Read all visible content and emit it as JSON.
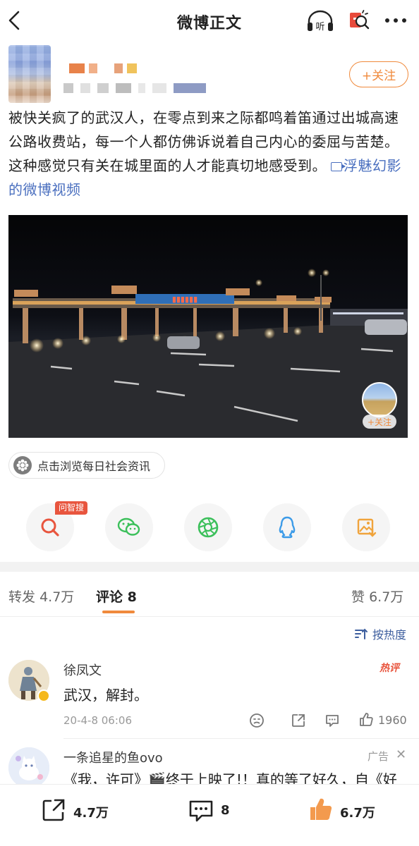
{
  "header": {
    "title": "微博正文",
    "back_icon": "chevron-left-icon",
    "listen_label": "听",
    "more_icon": "more-dots-icon"
  },
  "author": {
    "follow_label": "+关注"
  },
  "post": {
    "text": "被快关疯了的武汉人，在零点到来之际都鸣着笛通过出城高速公路收费站，每一个人都仿佛诉说着自己内心的委屈与苦楚。这种感觉只有关在城里面的人才能真切地感受到。",
    "video_link": "浮魅幻影的微博视频"
  },
  "video": {
    "follow_label": "+关注"
  },
  "topic_chip": {
    "label": "点击浏览每日社会资讯"
  },
  "share_row": {
    "ai_badge": "问智搜",
    "items": [
      "ai-search-icon",
      "wechat-icon",
      "moments-icon",
      "qq-icon",
      "save-image-icon"
    ]
  },
  "tabs": {
    "repost_label": "转发",
    "repost_count": "4.7万",
    "comment_label": "评论",
    "comment_count": "8",
    "like_label": "赞",
    "like_count": "6.7万"
  },
  "sort": {
    "label": "按热度"
  },
  "comments": [
    {
      "name": "徐凤文",
      "text": "武汉，解封。",
      "time": "20-4-8 06:06",
      "hot_tag": "热评",
      "likes": "1960"
    }
  ],
  "ad": {
    "name": "一条追星的鱼ovo",
    "tag": "广告",
    "close": "✕",
    "text": "《我，许可》🎬终于上映了!！真的等了好久，自《好"
  },
  "bottom_bar": {
    "repost_count": "4.7万",
    "comment_count": "8",
    "like_count": "6.7万"
  },
  "colors": {
    "accent": "#f08a3c",
    "link": "#4a6fbf",
    "hot": "#e8553e"
  }
}
